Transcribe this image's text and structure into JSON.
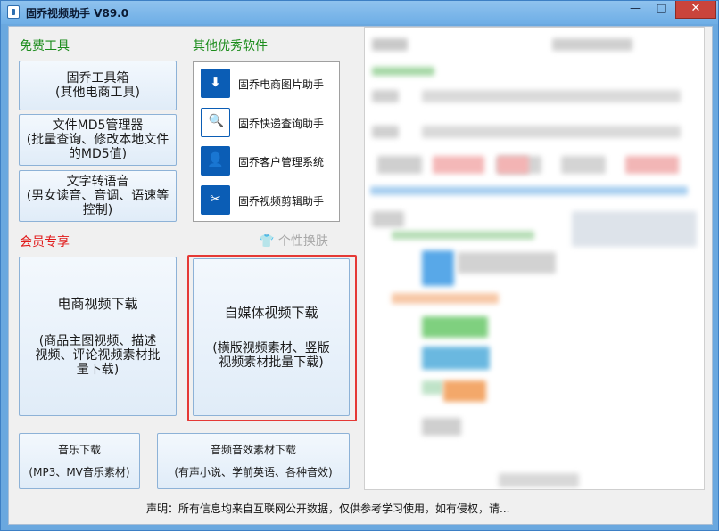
{
  "window": {
    "title": "固乔视频助手 V89.0",
    "controls": {
      "minimize": "—",
      "maximize": "□",
      "close": "✕"
    }
  },
  "free_tools": {
    "title": "免费工具",
    "buttons": [
      {
        "lines": [
          "固乔工具箱",
          "(其他电商工具)"
        ]
      },
      {
        "lines": [
          "文件MD5管理器",
          "(批量查询、修改本地文件",
          "的MD5值)"
        ]
      },
      {
        "lines": [
          "文字转语音",
          "(男女读音、音调、语速等",
          "控制)"
        ]
      }
    ]
  },
  "other_software": {
    "title": "其他优秀软件",
    "items": [
      {
        "label": "固乔电商图片助手",
        "icon": "download-icon"
      },
      {
        "label": "固乔快递查询助手",
        "icon": "express-search-icon"
      },
      {
        "label": "固乔客户管理系统",
        "icon": "customer-icon"
      },
      {
        "label": "固乔视频剪辑助手",
        "icon": "scissors-icon"
      }
    ]
  },
  "member": {
    "title": "会员专享",
    "skin_label": "个性换肤",
    "ecom_video": {
      "title": "电商视频下载",
      "desc": [
        "(商品主图视频、描述",
        "视频、评论视频素材批",
        "量下载)"
      ]
    },
    "media_video": {
      "title": "自媒体视频下载",
      "desc": [
        "(横版视频素材、竖版",
        "视频素材批量下载)"
      ]
    }
  },
  "audio": {
    "music": {
      "title": "音乐下载",
      "desc": "(MP3、MV音乐素材)"
    },
    "effects": {
      "title": "音频音效素材下载",
      "desc": "(有声小说、学前英语、各种音效)"
    }
  },
  "footer": {
    "disclaimer": "声明：所有信息均来自互联网公开数据，仅供参考学习使用，如有侵权，请..."
  },
  "colors": {
    "accent_green": "#1c8c1c",
    "accent_red": "#e11b1b",
    "highlight_frame": "#e53935",
    "titlebar": "#6eaee6"
  }
}
